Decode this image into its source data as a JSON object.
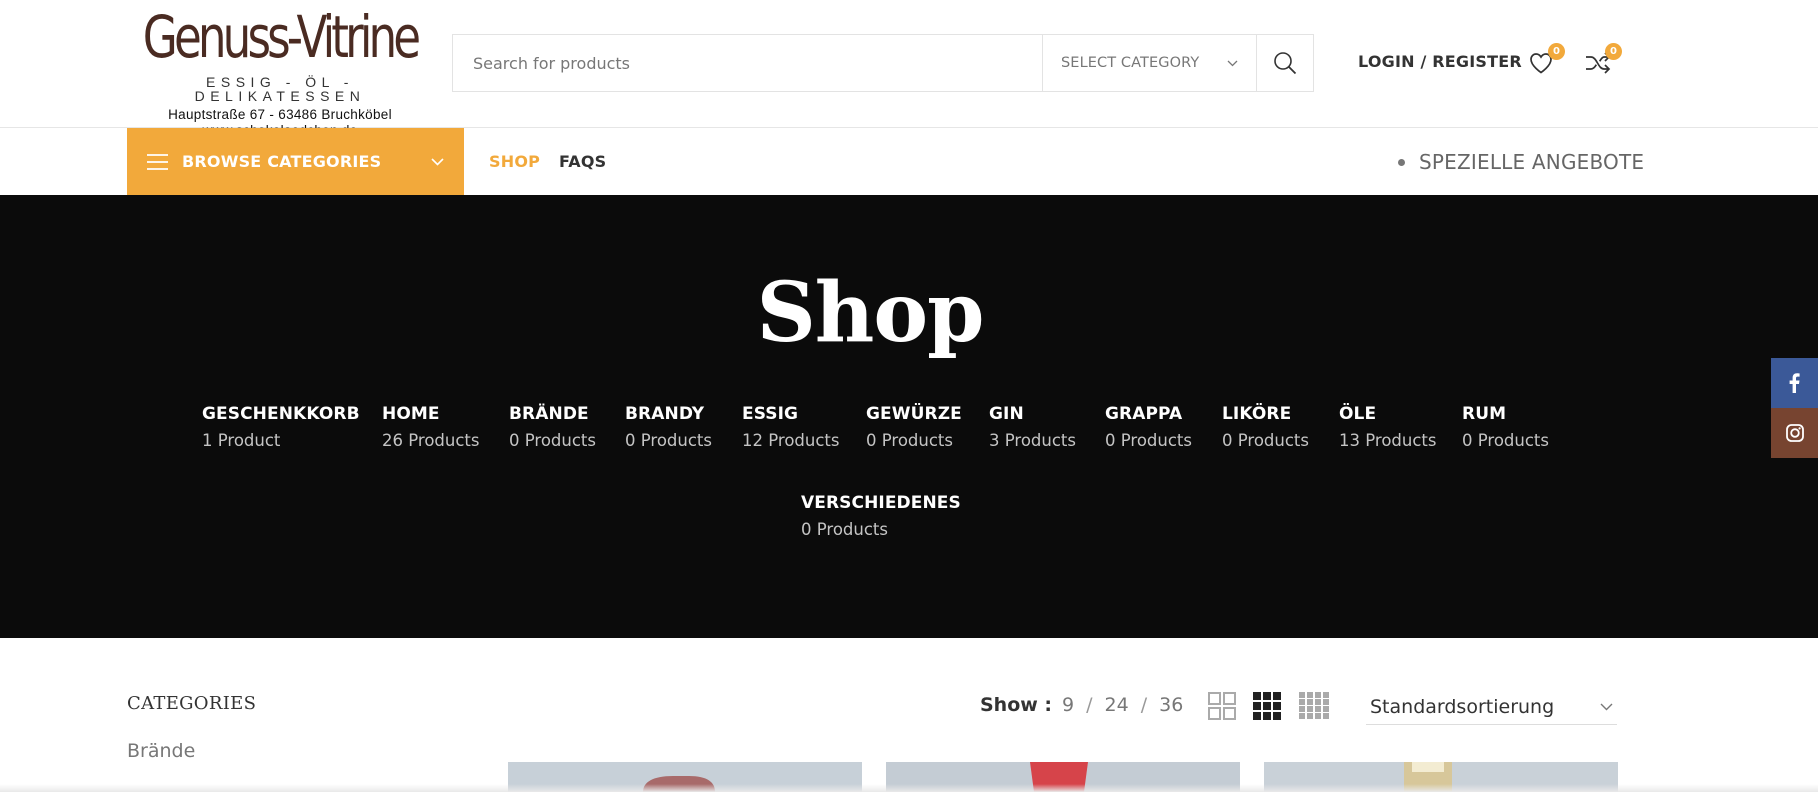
{
  "logo": {
    "title": "Genuss-Vitrine",
    "subtitle": "ESSIG - ÖL - DELIKATESSEN",
    "address": "Hauptstraße 67 - 63486 Bruchköbel",
    "website": "www.schokolaedchen.de"
  },
  "search": {
    "placeholder": "Search for products",
    "category": "SELECT CATEGORY"
  },
  "header": {
    "login": "LOGIN / REGISTER",
    "wishlist_count": "0",
    "compare_count": "0"
  },
  "nav": {
    "browse": "BROWSE CATEGORIES",
    "links": [
      "SHOP",
      "FAQS"
    ],
    "offers": "SPEZIELLE ANGEBOTE"
  },
  "hero": {
    "title": "Shop",
    "categories": [
      {
        "name": "GESCHENKKORB",
        "count": "1 Product"
      },
      {
        "name": "HOME",
        "count": "26 Products"
      },
      {
        "name": "BRÄNDE",
        "count": "0 Products"
      },
      {
        "name": "BRANDY",
        "count": "0 Products"
      },
      {
        "name": "ESSIG",
        "count": "12 Products"
      },
      {
        "name": "GEWÜRZE",
        "count": "0 Products"
      },
      {
        "name": "GIN",
        "count": "3 Products"
      },
      {
        "name": "GRAPPA",
        "count": "0 Products"
      },
      {
        "name": "LIKÖRE",
        "count": "0 Products"
      },
      {
        "name": "ÖLE",
        "count": "13 Products"
      },
      {
        "name": "RUM",
        "count": "0 Products"
      },
      {
        "name": "VERSCHIEDENES",
        "count": "0 Products"
      }
    ]
  },
  "sidebar": {
    "title": "CATEGORIES",
    "first_item": "Brände"
  },
  "toolbar": {
    "show_label": "Show :",
    "show_options": [
      "9",
      "24",
      "36"
    ],
    "separator": "/",
    "sort": "Standardsortierung"
  },
  "colors": {
    "accent": "#f2a93b",
    "hero_bg": "#0b0b0b",
    "facebook": "#3b5998",
    "instagram": "#774430",
    "logo": "#4a2b22"
  }
}
